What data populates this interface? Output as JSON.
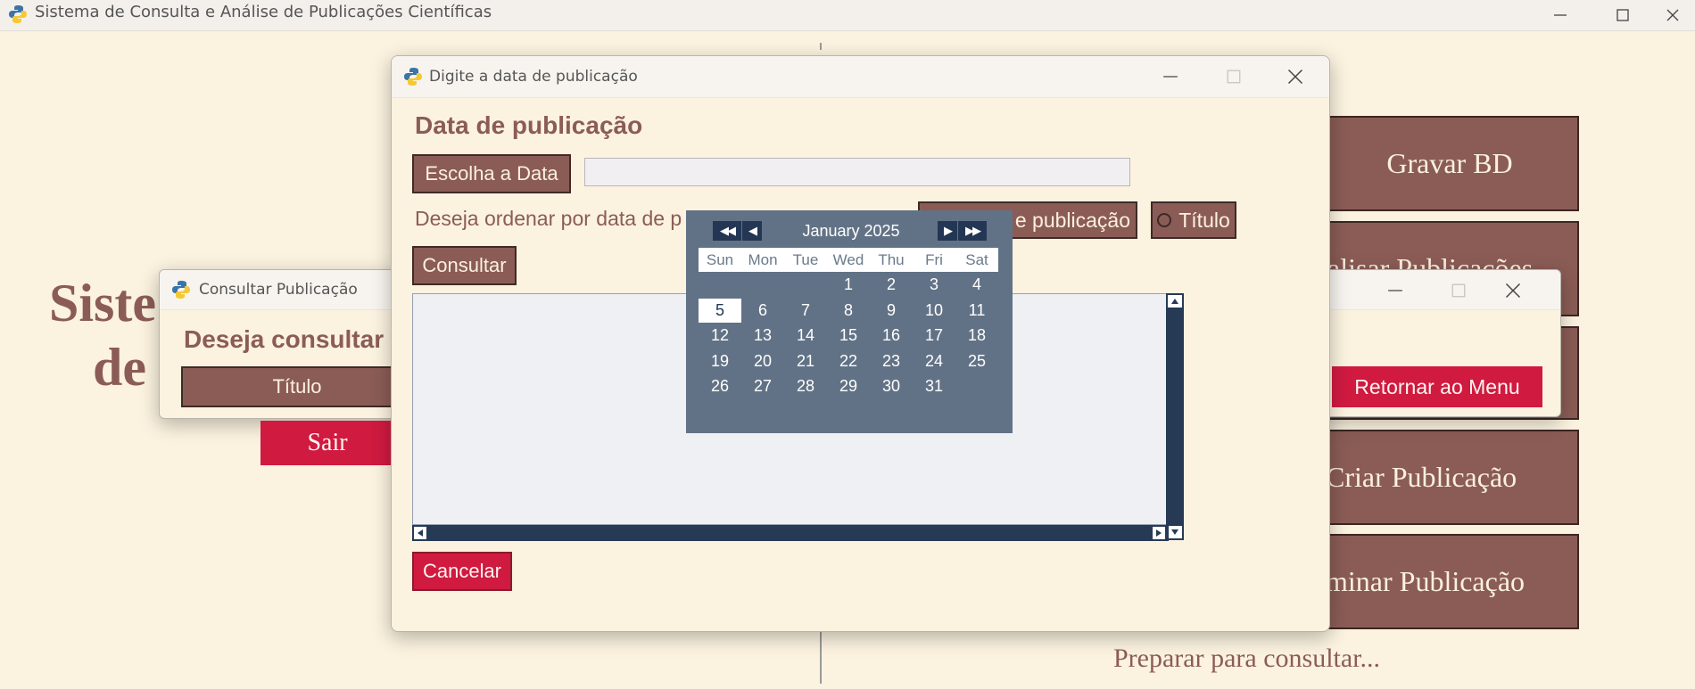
{
  "main_window": {
    "title": "Sistema de Consulta e Análise de Publicações Científicas",
    "title_fragment_1": "Siste",
    "title_fragment_2": "de",
    "buttons": {
      "gravar": "Gravar BD",
      "visualizar": "alisar Publicações",
      "criar": "Criar Publicação",
      "eliminar": "minar Publicação"
    },
    "status": "Preparar para consultar..."
  },
  "consultar_dialog": {
    "title": "Consultar Publicação",
    "heading": "Deseja consultar",
    "titulo_button": "Título",
    "sair_button": "Sair"
  },
  "back_dialog": {
    "retornar_button": "Retornar ao Menu"
  },
  "date_dialog": {
    "title": "Digite a data de publicação",
    "heading": "Data de publicação",
    "choose_button": "Escolha a Data",
    "date_value": "",
    "order_question": "Deseja ordenar por data de p",
    "order_option_date": "e publicação",
    "order_option_title": "Título",
    "consultar_button": "Consultar",
    "cancel_button": "Cancelar"
  },
  "calendar": {
    "month_year": "January 2025",
    "nav": {
      "prev_year": "◀◀",
      "prev_month": "◀",
      "next_month": "▶",
      "next_year": "▶▶"
    },
    "weekdays": [
      "Sun",
      "Mon",
      "Tue",
      "Wed",
      "Thu",
      "Fri",
      "Sat"
    ],
    "first_weekday_index": 3,
    "days_in_month": 31,
    "selected_day": 5
  },
  "colors": {
    "background": "#fbf2df",
    "brown_button": "#8b5c56",
    "red_button": "#d01a40",
    "calendar_bg": "#627286",
    "calendar_nav": "#233754",
    "scrollbar": "#263a56"
  }
}
